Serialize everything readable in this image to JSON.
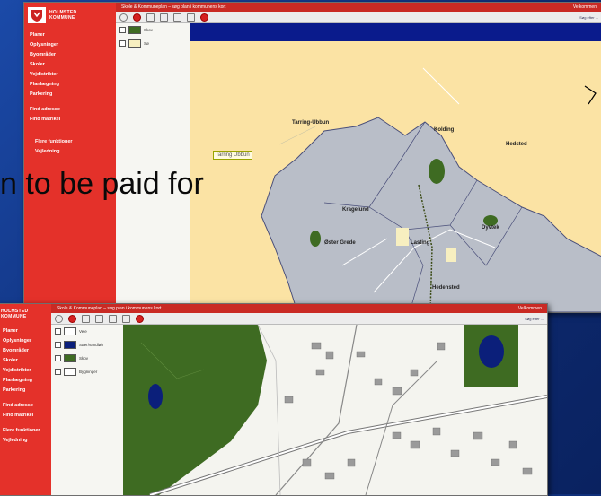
{
  "slide": {
    "caption": "n to be paid for"
  },
  "window_top": {
    "logo": {
      "line1": "HOLMSTED",
      "line2": "KOMMUNE"
    },
    "title_bar": "Skole & Kommuneplan – søg plan i kommunens kort",
    "title_right": "Velkommen",
    "toolbar_right": "Søg efter ...",
    "menu": [
      "Planer",
      "Oplysninger",
      "Byområder",
      "Skoler",
      "Vejdistrikter",
      "Planlægning",
      "Parkering"
    ],
    "menu_bottom": [
      "Find adresse",
      "Find matrikel"
    ],
    "menu_footer": [
      "Flere funktioner",
      "Vejledning"
    ],
    "legend": [
      {
        "label": "Skov",
        "color": "#3e6b22"
      },
      {
        "label": "Sø",
        "color": "#f7efc0"
      }
    ],
    "places": {
      "tarm_top": "Tarring-Ubbun",
      "tarm_box": "Tarring Ubbun",
      "kolding": "Kolding",
      "hedsted": "Hedsted",
      "kragelund": "Kragelund",
      "over_grede": "Øster Grede",
      "lasting": "Lasting",
      "hedensted": "Hedensted",
      "dyvtek": "Dyvtek"
    },
    "colors": {
      "sidebar": "#e4312a",
      "map_bg": "#fbe3a4",
      "region": "#b9bec8"
    }
  },
  "window_bottom": {
    "logo": {
      "line1": "HOLMSTED",
      "line2": "KOMMUNE"
    },
    "title_bar": "Skole & Kommuneplan – søg plan i kommunens kort",
    "title_right": "Velkommen",
    "toolbar_right": "Søg efter ...",
    "menu": [
      "Planer",
      "Oplysninger",
      "Byområder",
      "Skoler",
      "Vejdistrikter",
      "Planlægning",
      "Parkering"
    ],
    "menu_bottom": [
      "Find adresse",
      "Find matrikel"
    ],
    "menu_footer": [
      "Flere funktioner",
      "Vejledning"
    ],
    "legend": [
      {
        "label": "Veje",
        "color": "#ffffff"
      },
      {
        "label": "Søer/vandløb",
        "color": "#0b1f7a"
      },
      {
        "label": "Skov",
        "color": "#3e6b22"
      },
      {
        "label": "Bygninger",
        "color": "#ffffff"
      }
    ],
    "colors": {
      "forest": "#3e6b22",
      "water": "#0b1f7a"
    }
  }
}
